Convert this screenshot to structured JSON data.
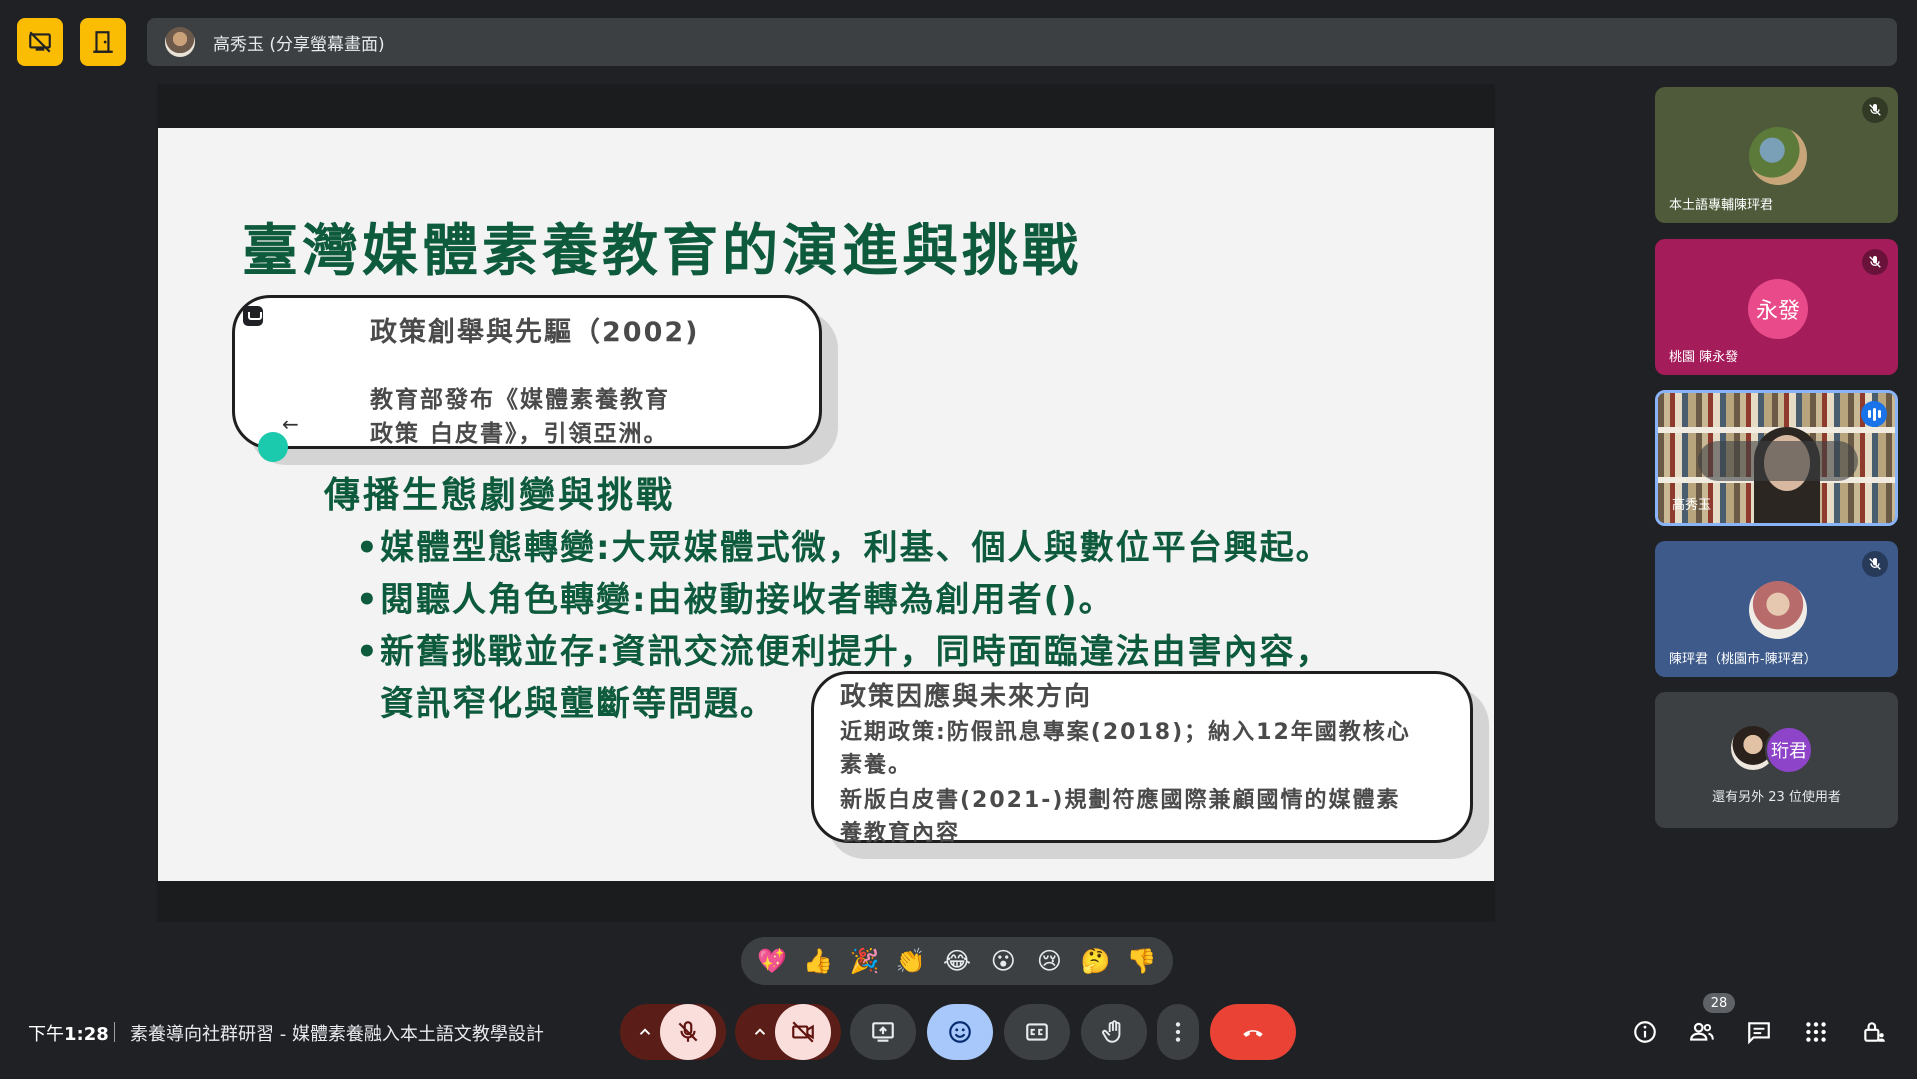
{
  "header": {
    "presenter_name": "高秀玉 (分享螢幕畫面)"
  },
  "slide": {
    "title": "臺灣媒體素養教育的演進與挑戰",
    "callout1": {
      "heading": "政策創舉與先驅（2002)",
      "lines": [
        "教育部發布《媒體素養教育",
        "政策  白皮書》，引領亞洲。"
      ]
    },
    "section_heading": "傳播生態劇變與挑戰",
    "bullets": [
      "媒體型態轉變:大眾媒體式微，利基、個人與數位平台興起。",
      "閱聽人角色轉變:由被動接收者轉為創用者()。",
      "新舊挑戰並存:資訊交流便利提升，同時面臨違法由害內容，",
      "資訊窄化與壟斷等問題。"
    ],
    "callout2": {
      "heading": "政策因應與未來方向",
      "lines": [
        "近期政策:防假訊息專案(2018)；納入12年國教核心",
        "素養。",
        "新版白皮書(2021-)規劃符應國際兼顧國情的媒體素",
        "養教育內容"
      ]
    }
  },
  "participants": [
    {
      "name": "本土語專輔陳玶君",
      "muted": true,
      "bg": "#4e5a3a"
    },
    {
      "name": "桃園 陳永發",
      "avatar_text": "永發",
      "muted": true,
      "bg": "#a51c5a"
    },
    {
      "name": "高秀玉",
      "speaking": true
    },
    {
      "name": "陳玶君（桃園市-陳玶君）",
      "muted": true,
      "bg": "#3d5a8a"
    }
  ],
  "more_participants": {
    "avatar_text": "珩君",
    "label": "還有另外 23 位使用者"
  },
  "reactions": [
    "💖",
    "👍",
    "🎉",
    "👏",
    "😂",
    "😮",
    "😢",
    "🤔",
    "👎"
  ],
  "footer": {
    "time_prefix": "下午",
    "time": "1:28",
    "meeting_title": "素養導向社群研習 - 媒體素養融入本土語文教學設計",
    "people_count": "28"
  },
  "colors": {
    "slide_green": "#0d5a3c",
    "accent_yellow": "#fbbc04",
    "leave_red": "#ea4335",
    "active_blue": "#a8c7fa"
  }
}
